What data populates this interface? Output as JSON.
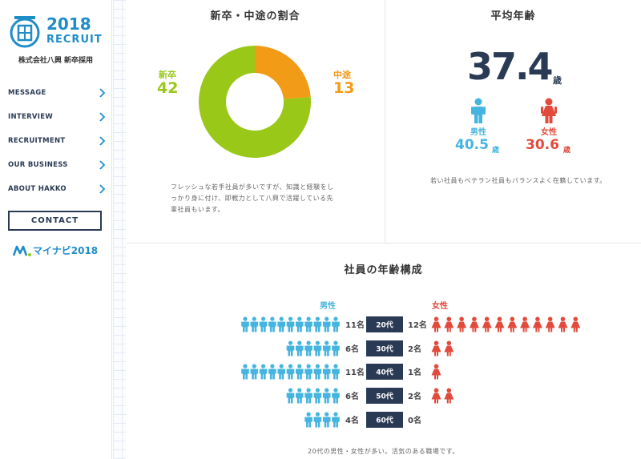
{
  "sidebar": {
    "logo_year": "2018",
    "logo_recruit": "RECRUIT",
    "company": "株式会社八興 新卒採用",
    "nav": [
      "MESSAGE",
      "INTERVIEW",
      "RECRUITMENT",
      "OUR BUSINESS",
      "ABOUT HAKKO"
    ],
    "contact_label": "CONTACT",
    "mynavi_label": "マイナビ2018"
  },
  "ratio": {
    "title": "新卒・中途の割合",
    "new_label": "新卒",
    "new_value": "42",
    "mid_label": "中途",
    "mid_value": "13",
    "desc_lines": [
      "フレッシュな若手社員が多いですが、知識と経験をし",
      "っかり身に付け、即戦力として八興で活躍している先",
      "輩社員もいます。"
    ]
  },
  "avg_age": {
    "title": "平均年齢",
    "value": "37.4",
    "unit": "歳",
    "male_label": "男性",
    "male_value": "40.5",
    "female_label": "女性",
    "female_value": "30.6",
    "desc": "若い社員もベテラン社員もバランスよく在籍しています。"
  },
  "age_composition": {
    "title": "社員の年齢構成",
    "male_header": "男性",
    "female_header": "女性",
    "rows": [
      {
        "age": "20代",
        "male": 11,
        "male_label": "11名",
        "female": 12,
        "female_label": "12名"
      },
      {
        "age": "30代",
        "male": 6,
        "male_label": "6名",
        "female": 2,
        "female_label": "2名"
      },
      {
        "age": "40代",
        "male": 11,
        "male_label": "11名",
        "female": 1,
        "female_label": "1名"
      },
      {
        "age": "50代",
        "male": 6,
        "male_label": "6名",
        "female": 2,
        "female_label": "2名"
      },
      {
        "age": "60代",
        "male": 4,
        "male_label": "4名",
        "female": 0,
        "female_label": "0名"
      }
    ],
    "desc": "20代の男性・女性が多い。活気のある職場です。"
  },
  "colors": {
    "navy": "#2a3a55",
    "brand_blue": "#1f8dc8",
    "green": "#99c818",
    "orange": "#f29b16",
    "male_blue": "#45b5e0",
    "female_red": "#e24a3b"
  }
}
